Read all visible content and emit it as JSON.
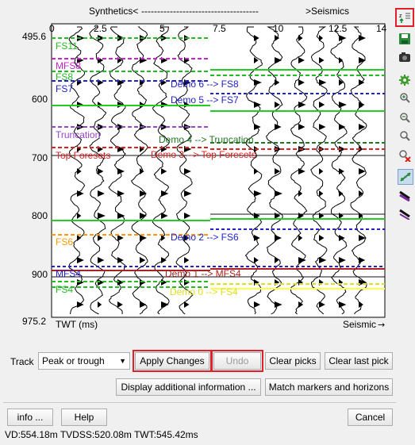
{
  "plot": {
    "top_left_label": "Synthetics<",
    "top_dashes": "-------------------------------------",
    "top_right_label": ">Seismics",
    "x_ticks": [
      "0",
      "2.5",
      "5",
      "7.5",
      "10",
      "12.5",
      "14"
    ],
    "y_ticks": [
      "495.6",
      "600",
      "700",
      "800",
      "900",
      "975.2"
    ],
    "y_axis_label": "TWT (ms)",
    "x_axis_label": "Seismic",
    "markers": [
      {
        "label": "FS11",
        "color": "#22bb22"
      },
      {
        "label": "MFS8",
        "color": "#cc22cc"
      },
      {
        "label": "FS8",
        "color": "#22bb22"
      },
      {
        "label": "FS7",
        "color": "#2222cc"
      },
      {
        "label": "Truncation",
        "color": "#9944cc"
      },
      {
        "label": "Top Foresets",
        "color": "#dd2222"
      },
      {
        "label": "FS6",
        "color": "#ff9900"
      },
      {
        "label": "MFS4",
        "color": "#2222cc"
      },
      {
        "label": "FS4",
        "color": "#22bb22"
      }
    ],
    "demo_labels": [
      {
        "text": "Demo 6 --> FS8",
        "color": "#2222cc"
      },
      {
        "text": "Demo 5 --> FS7",
        "color": "#2222cc"
      },
      {
        "text": "Demo 4 --> Truncation",
        "color": "#227722"
      },
      {
        "text": "Demo 3 --> Top Foresets",
        "color": "#dd2222"
      },
      {
        "text": "Demo 2 --> FS6",
        "color": "#2222cc"
      },
      {
        "text": "Demo 1 --> MFS4",
        "color": "#aa2222"
      },
      {
        "text": "Demo 0 --> FS4",
        "color": "#dddd22"
      }
    ]
  },
  "controls": {
    "track_label": "Track",
    "track_select": "Peak or trough",
    "apply_changes": "Apply Changes",
    "undo": "Undo",
    "clear_picks": "Clear picks",
    "clear_last_pick": "Clear last pick",
    "display_info": "Display additional information ...",
    "match_markers": "Match markers and horizons",
    "info": "info ...",
    "help": "Help",
    "cancel": "Cancel"
  },
  "toolbar": {
    "icons": [
      "zoom-direction-icon",
      "save-icon",
      "camera-icon",
      "settings-icon",
      "zoom-in-icon",
      "zoom-out-icon",
      "zoom-fit-icon",
      "delete-icon",
      "points-icon",
      "line-color-icon"
    ]
  },
  "status_bar": {
    "text": "VD:554.18m  TVDSS:520.08m  TWT:545.42ms"
  }
}
